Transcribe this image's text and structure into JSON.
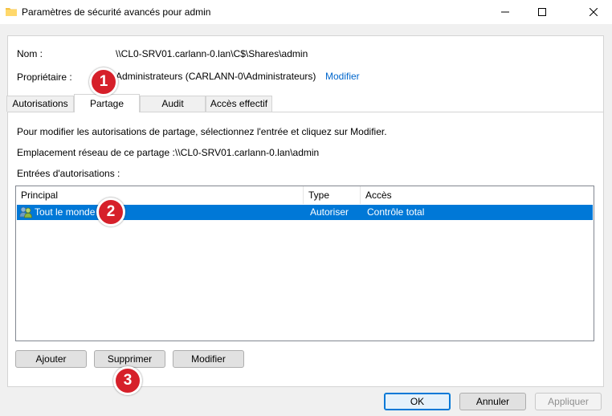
{
  "window": {
    "title": "Paramètres de sécurité avancés pour admin"
  },
  "fields": {
    "name_label": "Nom :",
    "name_value": "\\\\CL0-SRV01.carlann-0.lan\\C$\\Shares\\admin",
    "owner_label": "Propriétaire :",
    "owner_value": "Administrateurs (CARLANN-0\\Administrateurs)",
    "owner_modify": "Modifier"
  },
  "tabs": [
    {
      "label": "Autorisations"
    },
    {
      "label": "Partage",
      "active": true
    },
    {
      "label": "Audit"
    },
    {
      "label": "Accès effectif"
    }
  ],
  "share": {
    "instructions": "Pour modifier les autorisations de partage, sélectionnez l'entrée et cliquez sur Modifier.",
    "network_location_label": "Emplacement réseau de ce partage :",
    "network_location_value": "\\\\CL0-SRV01.carlann-0.lan\\admin",
    "entries_label": "Entrées d'autorisations :"
  },
  "list": {
    "columns": [
      "Principal",
      "Type",
      "Accès"
    ],
    "rows": [
      {
        "principal": "Tout le monde",
        "type": "Autoriser",
        "access": "Contrôle total",
        "selected": true
      }
    ]
  },
  "entry_buttons": {
    "add": "Ajouter",
    "remove": "Supprimer",
    "modify": "Modifier"
  },
  "dialog_buttons": {
    "ok": "OK",
    "cancel": "Annuler",
    "apply": "Appliquer"
  },
  "badges": [
    "1",
    "2",
    "3"
  ],
  "colors": {
    "selection": "#0078d7",
    "link": "#0066cc",
    "badge": "#d6202a"
  },
  "icons": [
    "folder-icon",
    "minimize-icon",
    "maximize-icon",
    "close-icon",
    "users-icon"
  ]
}
